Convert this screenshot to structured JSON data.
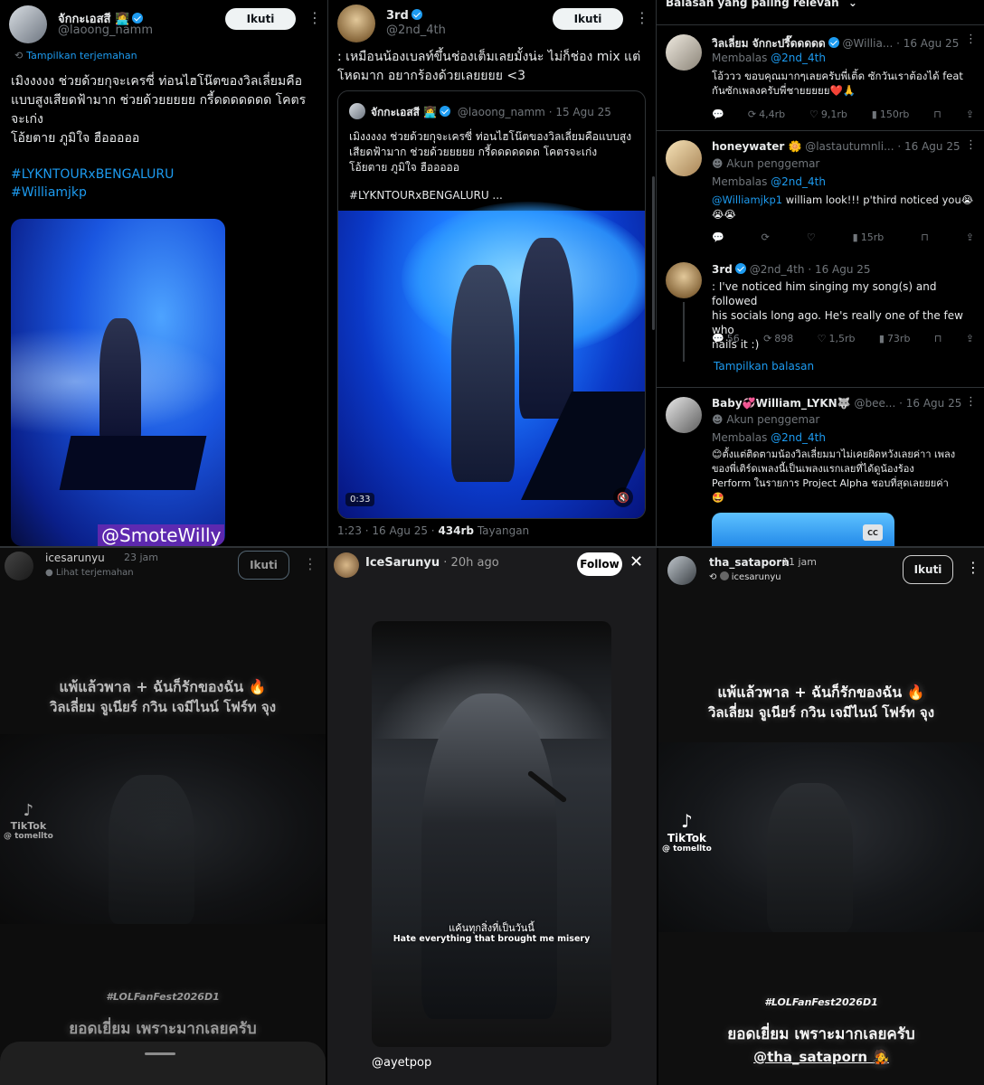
{
  "panel1": {
    "display_name": "จักกะเอสสี 👩‍💻",
    "handle": "@laoong_namm",
    "follow_label": "Ikuti",
    "translate_label": "Tampilkan terjemahan",
    "text_line1": "เมิงงงงง ช่วยด้วยกุจะเครซี่ ท่อนไฮโน๊ตของวิลเลี่ยมคือ",
    "text_line2": "แบบสูงเสียดฟ้ามาก ช่วยด้วยยยยย กรี้ดดดดดดด โคตร",
    "text_line3": "จะเก่ง",
    "text_line4": "โอ้ยตาย ภูมิใจ ฮือออออ",
    "hashtag1": "#LYKNTOURxBENGALURU",
    "hashtag2": "#Williamjkp",
    "watermark": "@SmoteWilly"
  },
  "panel2": {
    "display_name": "3rd",
    "handle": "@2nd_4th",
    "follow_label": "Ikuti",
    "text_line1": ": เหมือนน้องเบลท์ขึ้นช่องเต็มเลยมั้งน่ะ ไม่ก็ช่อง mix แต่",
    "text_line2": "โหดมาก อยากร้องด้วยเลยยยย <3",
    "quote_name": "จักกะเอสสี 👩‍💻",
    "quote_handle": "@laoong_namm",
    "quote_date": "· 15 Agu 25",
    "quote_line1": "เมิงงงงง ช่วยด้วยกุจะเครซี่ ท่อนไฮโน๊ตของวิลเลี่ยมคือแบบสูง",
    "quote_line2": "เสียดฟ้ามาก ช่วยด้วยยยยย กรี้ดดดดดดด โคตรจะเก่ง",
    "quote_line3": "โอ้ยตาย ภูมิใจ ฮือออออ",
    "quote_hashtag": "#LYKNTOURxBENGALURU ...",
    "video_time": "0:33",
    "meta_time": "1:23 · 16 Agu 25 · ",
    "views_count": "434rb",
    "views_label": " Tayangan"
  },
  "panel3": {
    "header": "Balasan yang paling relevan",
    "replies": [
      {
        "name": "วิลเลี่ยม จักกะปรี๊ดดดดด",
        "handle": "@Willia...",
        "date": "· 16 Agu 25",
        "reply_to_label": "Membalas ",
        "reply_to": "@2nd_4th",
        "line1": "โอ้ววว ขอบคุณมากๆเลยครับพี่เติ้ด ซักวันเราต้องได้ feat",
        "line2": "กันซักเพลงครับพี่ชายยยยย❤️🙏",
        "replies_count": "",
        "retweets": "4,4rb",
        "likes": "9,1rb",
        "views": "150rb"
      },
      {
        "name": "honeywater 🌼",
        "handle": "@lastautumnli...",
        "date": "· 16 Agu 25",
        "fan_label": "Akun penggemar",
        "reply_to_label": "Membalas ",
        "reply_to": "@2nd_4th",
        "mention": "@Williamjkp1",
        "line1": " william look!!! p'third noticed you😭",
        "line2": "😭😭",
        "views": "15rb"
      },
      {
        "name": "3rd",
        "handle": "@2nd_4th",
        "date": "· 16 Agu 25",
        "line1": ": I've noticed him singing my song(s) and followed",
        "line2": "his socials long ago. He's really one of the few who",
        "line3": "nails it :)",
        "replies_count": "56",
        "retweets": "898",
        "likes": "1,5rb",
        "views": "73rb",
        "show_replies": "Tampilkan balasan"
      },
      {
        "name": "Baby💞William_LYKN🐺",
        "handle": "@bee...",
        "date": "· 16 Agu 25",
        "fan_label": "Akun penggemar",
        "reply_to_label": "Membalas ",
        "reply_to": "@2nd_4th",
        "line1": "😊ตั้งแต่ติดตามน้องวิลเลี่ยมมาไม่เคยผิดหวังเลยค่าา เพลง",
        "line2": "ของพี่เติร์ดเพลงนี้เป็นเพลงแรกเลยที่ได้ดูน้องร้อง",
        "line3": "Perform ในรายการ Project Alpha ชอบที่สุดเลยยยค่า",
        "line4": "🤩",
        "cc_label": "CC"
      }
    ]
  },
  "panel4": {
    "username": "icesarunyu",
    "time": "23 jam",
    "translate_label": "Lihat terjemahan",
    "follow_label": "Ikuti",
    "title_line1": "แพ้แล้วพาล + ฉันก็รักของฉัน 🔥",
    "title_line2": "วิลเลี่ยม จูเนียร์ กวิน  เจมีไนน์ โฟร์ท จุง",
    "tiktok_label": "TikTok",
    "tiktok_user": "@ tomellto",
    "hashtag": "#LOLFanFest2026D1",
    "caption": "ยอดเยี่ยม เพราะมากเลยครับ"
  },
  "panel5": {
    "username": "IceSarunyu",
    "time": "· 20h ago",
    "follow_label": "Follow",
    "subtitle_th": "แค้นทุกสิ่งที่เป็นวันนี้",
    "subtitle_en": "Hate everything that brought me misery",
    "mention": "@ayetpop"
  },
  "panel6": {
    "username": "tha_sataporn",
    "time": "11 jam",
    "repost_user": "icesarunyu",
    "follow_label": "Ikuti",
    "title_line1": "แพ้แล้วพาล + ฉันก็รักของฉัน 🔥",
    "title_line2": "วิลเลี่ยม จูเนียร์ กวิน  เจมีไนน์ โฟร์ท จุง",
    "tiktok_label": "TikTok",
    "tiktok_user": "@ tomellto",
    "hashtag": "#LOLFanFest2026D1",
    "caption": "ยอดเยี่ยม เพราะมากเลยครับ",
    "mention": "@tha_sataporn 🧑‍🎤"
  }
}
